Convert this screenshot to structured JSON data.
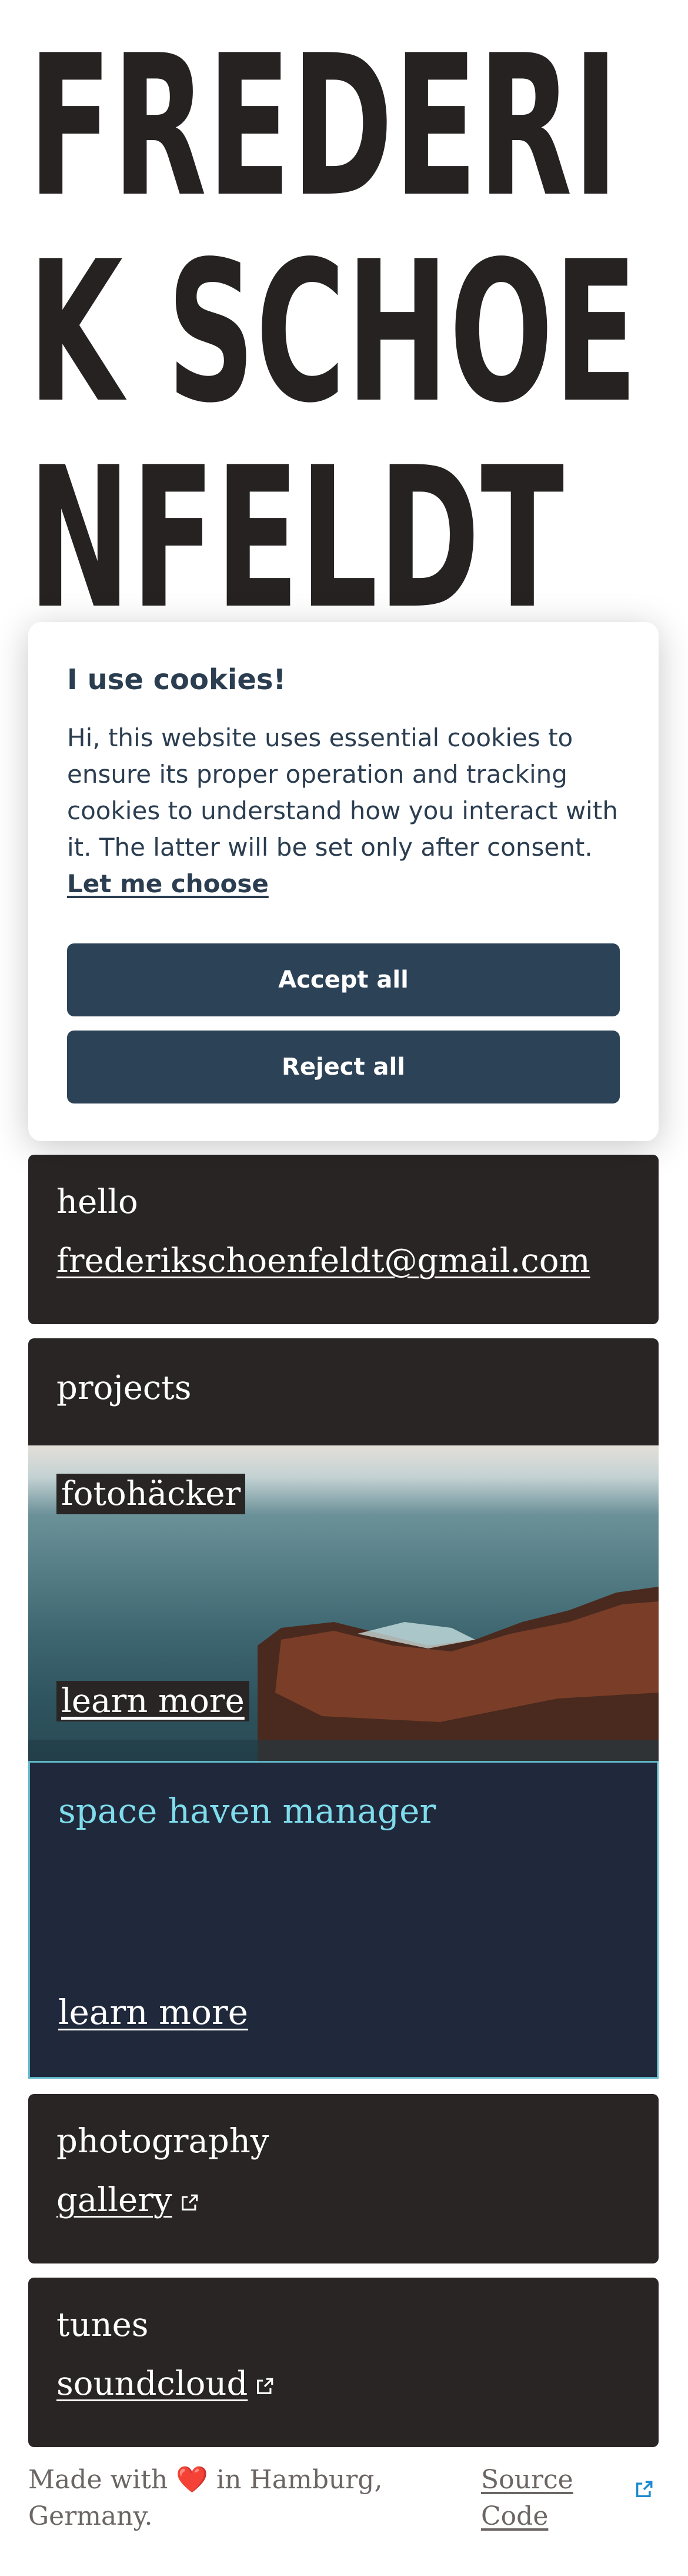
{
  "hero": {
    "lines": [
      "FREDERI",
      "K SCHOE",
      "NFELDT"
    ]
  },
  "cookie_banner": {
    "title": "I use cookies!",
    "body": "Hi, this website uses essential cookies to ensure its proper operation and tracking cookies to understand how you interact with it. The latter will be set only after consent.",
    "choose_label": "Let me choose",
    "accept_label": "Accept all",
    "reject_label": "Reject all"
  },
  "hello": {
    "title": "hello",
    "email": "frederikschoenfeldt@gmail.com"
  },
  "projects": {
    "title": "projects",
    "items": [
      {
        "name": "fotohäcker",
        "link": "learn more"
      },
      {
        "name": "space haven manager",
        "link": "learn more"
      }
    ]
  },
  "photography": {
    "title": "photography",
    "link": "gallery"
  },
  "tunes": {
    "title": "tunes",
    "link": "soundcloud"
  },
  "footer": {
    "made_prefix": "Made with",
    "heart": "❤️",
    "made_suffix": "in Hamburg, Germany.",
    "source_label": "Source Code"
  },
  "icons": {
    "external": "external-link-icon",
    "heart": "heart-icon"
  },
  "colors": {
    "card": "#292524",
    "accent_cyan": "#7fdcec",
    "button": "#2c4257",
    "space_bg": "#1f293b"
  }
}
